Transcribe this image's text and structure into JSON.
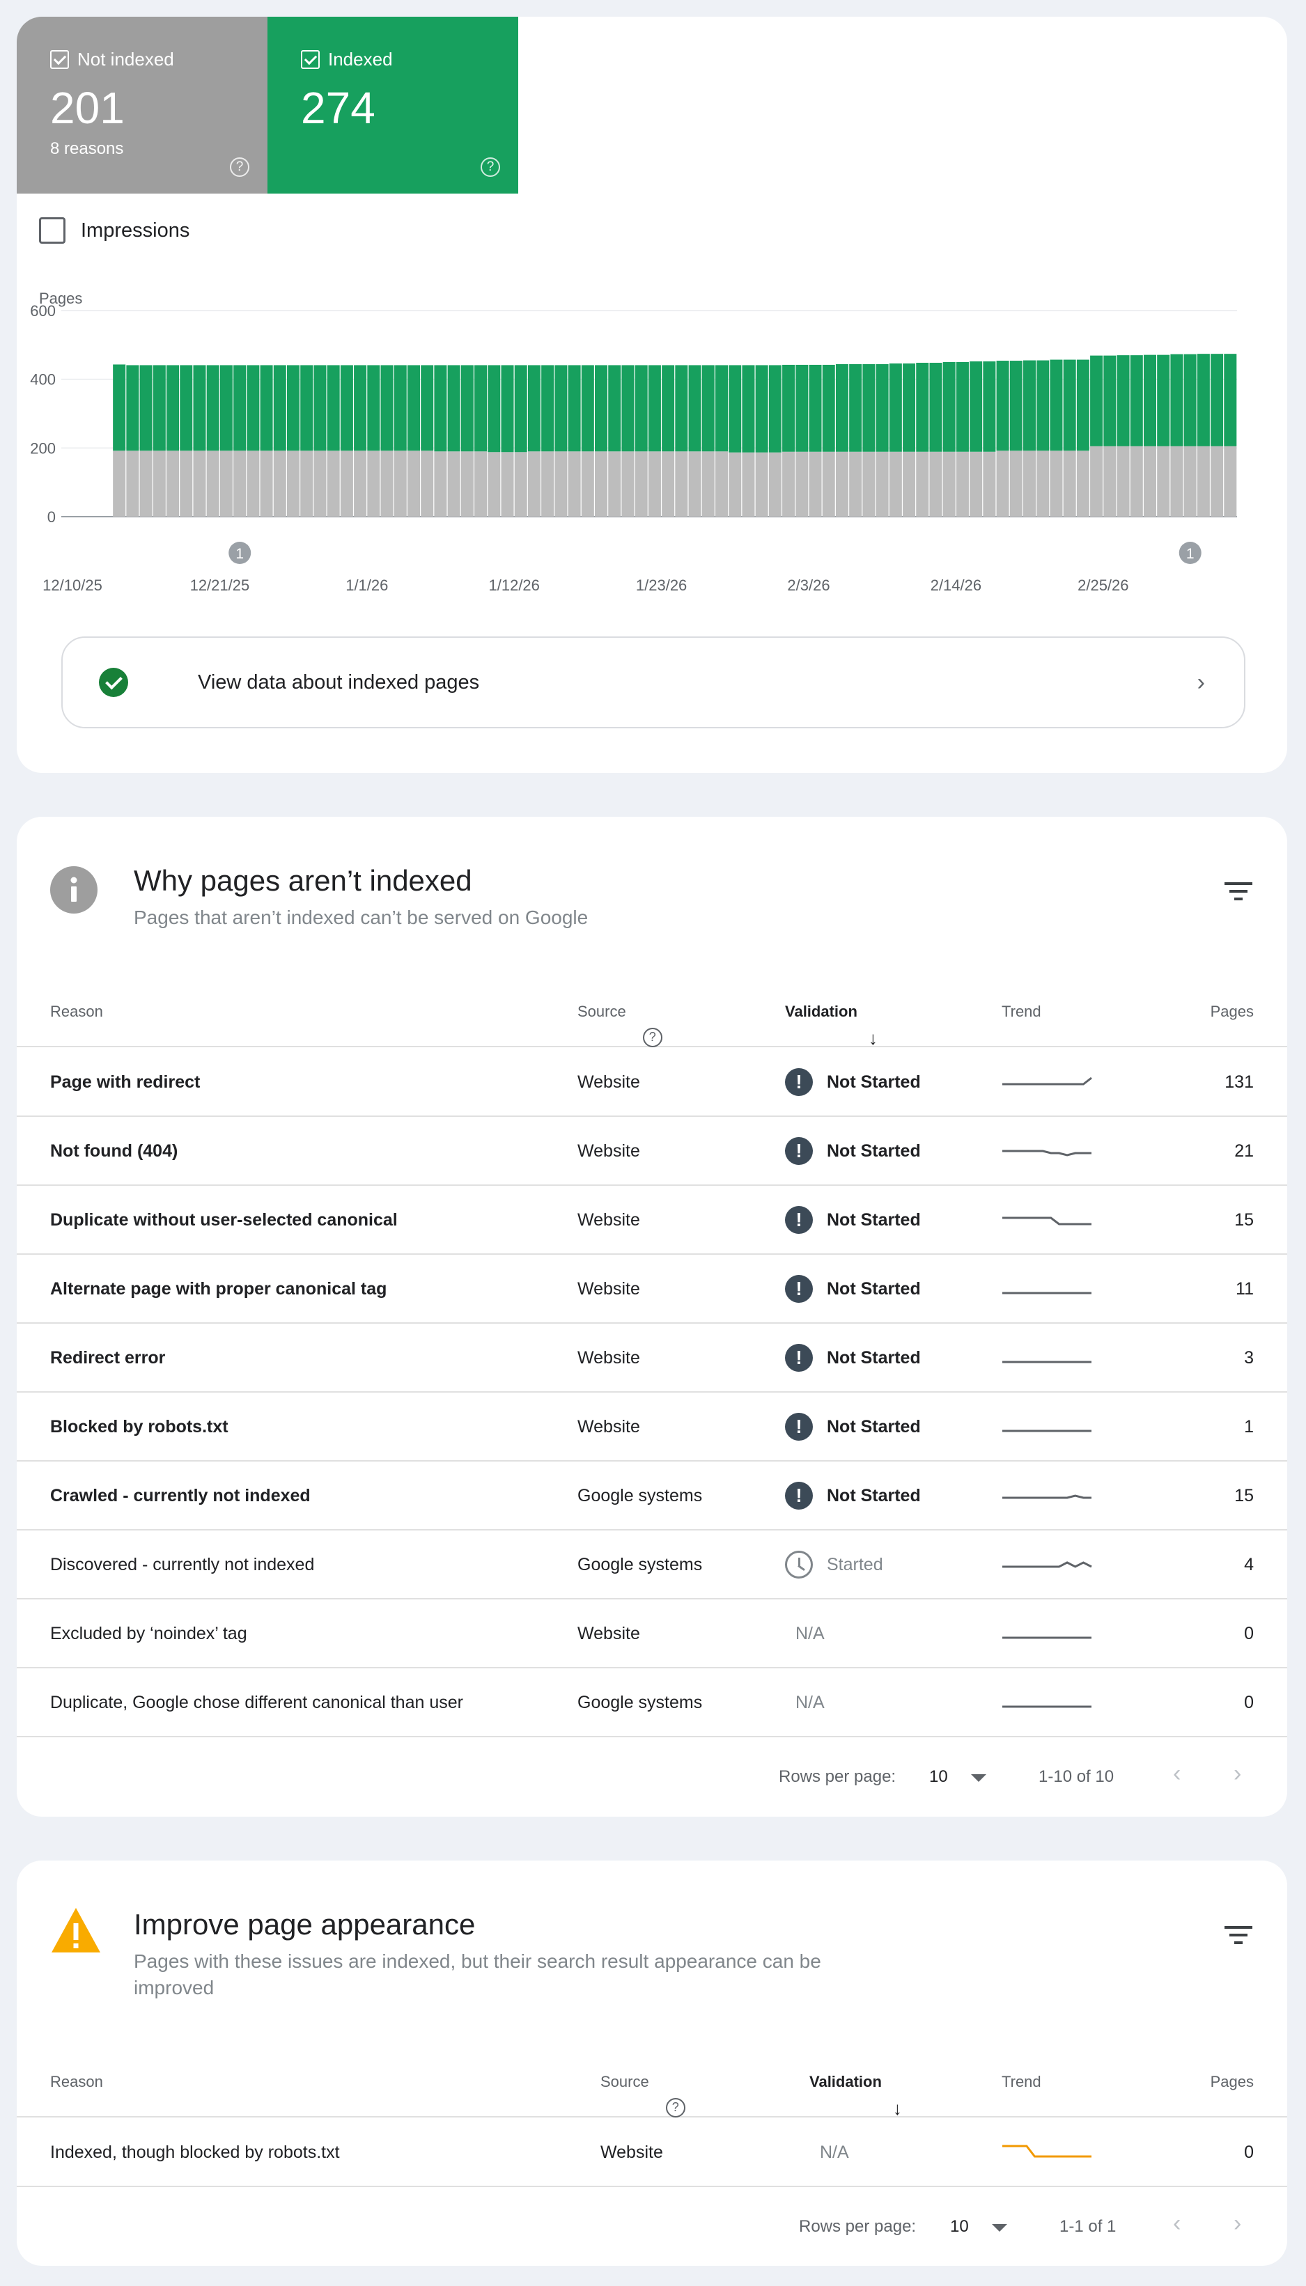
{
  "summary": {
    "not_indexed": {
      "label": "Not indexed",
      "value": "201",
      "sub": "8 reasons",
      "color": "#9e9e9e"
    },
    "indexed": {
      "label": "Indexed",
      "value": "274",
      "color": "#17a05e"
    }
  },
  "impressions_label": "Impressions",
  "chart_data": {
    "type": "bar",
    "stacked": true,
    "ylabel": "Pages",
    "ylim": [
      0,
      600
    ],
    "yticks": [
      "600",
      "400",
      "200",
      "0"
    ],
    "xtick_labels": [
      "12/10/25",
      "12/21/25",
      "1/1/26",
      "1/12/26",
      "1/23/26",
      "2/3/26",
      "2/14/26",
      "2/25/26"
    ],
    "annotations": [
      {
        "label": "1",
        "date": "12/22/25"
      },
      {
        "label": "1",
        "date": "3/3/26"
      }
    ],
    "series": [
      {
        "name": "Not indexed",
        "color": "#bdbdbd",
        "values": [
          192,
          192,
          192,
          192,
          192,
          192,
          192,
          192,
          192,
          192,
          192,
          192,
          192,
          192,
          192,
          192,
          192,
          192,
          192,
          192,
          192,
          192,
          192,
          192,
          190,
          190,
          190,
          190,
          188,
          188,
          188,
          190,
          190,
          190,
          190,
          190,
          190,
          190,
          190,
          190,
          190,
          190,
          190,
          190,
          190,
          190,
          187,
          187,
          187,
          187,
          189,
          189,
          189,
          189,
          189,
          189,
          189,
          189,
          189,
          189,
          189,
          189,
          189,
          189,
          189,
          189,
          192,
          192,
          192,
          192,
          192,
          192,
          192,
          205,
          205,
          205,
          205,
          205,
          205,
          205,
          205,
          205,
          205,
          205
        ]
      },
      {
        "name": "Indexed",
        "color": "#17a05e",
        "values": [
          251,
          249,
          249,
          249,
          249,
          249,
          249,
          249,
          249,
          249,
          249,
          249,
          249,
          249,
          249,
          249,
          249,
          249,
          249,
          249,
          249,
          249,
          249,
          249,
          251,
          251,
          251,
          251,
          253,
          253,
          253,
          251,
          251,
          251,
          251,
          251,
          251,
          251,
          251,
          251,
          251,
          251,
          251,
          251,
          251,
          251,
          254,
          254,
          254,
          254,
          253,
          253,
          253,
          253,
          255,
          255,
          255,
          255,
          257,
          257,
          259,
          259,
          261,
          261,
          263,
          263,
          262,
          262,
          263,
          263,
          265,
          265,
          265,
          264,
          264,
          265,
          265,
          266,
          266,
          268,
          268,
          269,
          269,
          269
        ]
      }
    ]
  },
  "view_data_label": "View data about indexed pages",
  "why": {
    "title": "Why pages aren’t indexed",
    "subtitle": "Pages that aren’t indexed can’t be served on Google",
    "headers": {
      "reason": "Reason",
      "source": "Source",
      "validation": "Validation",
      "trend": "Trend",
      "pages": "Pages"
    },
    "rows": [
      {
        "reason": "Page with redirect",
        "source": "Website",
        "status": "Not Started",
        "kind": "ns",
        "pages": "131",
        "trend": [
          4,
          4,
          4,
          4,
          4,
          4,
          4,
          4,
          4,
          4,
          4,
          1
        ]
      },
      {
        "reason": "Not found (404)",
        "source": "Website",
        "status": "Not Started",
        "kind": "ns",
        "pages": "21",
        "trend": [
          3,
          3,
          3,
          3,
          3,
          3,
          4,
          4,
          5,
          4,
          4,
          4
        ]
      },
      {
        "reason": "Duplicate without user-selected canonical",
        "source": "Website",
        "status": "Not Started",
        "kind": "ns",
        "pages": "15",
        "trend": [
          2,
          2,
          2,
          2,
          2,
          2,
          2,
          5,
          5,
          5,
          5,
          5
        ]
      },
      {
        "reason": "Alternate page with proper canonical tag",
        "source": "Website",
        "status": "Not Started",
        "kind": "ns",
        "pages": "11",
        "trend": [
          5,
          5,
          5,
          5,
          5,
          5,
          5,
          5,
          5,
          5,
          5,
          5
        ]
      },
      {
        "reason": "Redirect error",
        "source": "Website",
        "status": "Not Started",
        "kind": "ns",
        "pages": "3",
        "trend": [
          5,
          5,
          5,
          5,
          5,
          5,
          5,
          5,
          5,
          5,
          5,
          5
        ]
      },
      {
        "reason": "Blocked by robots.txt",
        "source": "Website",
        "status": "Not Started",
        "kind": "ns",
        "pages": "1",
        "trend": [
          5,
          5,
          5,
          5,
          5,
          5,
          5,
          5,
          5,
          5,
          5,
          5
        ]
      },
      {
        "reason": "Crawled - currently not indexed",
        "source": "Google systems",
        "status": "Not Started",
        "kind": "ns",
        "pages": "15",
        "trend": [
          4,
          4,
          4,
          4,
          4,
          4,
          4,
          4,
          4,
          3,
          4,
          4
        ]
      },
      {
        "reason": "Discovered - currently not indexed",
        "source": "Google systems",
        "status": "Started",
        "kind": "started",
        "pages": "4",
        "trend": [
          4,
          4,
          4,
          4,
          4,
          4,
          4,
          4,
          2,
          4,
          2,
          4
        ]
      },
      {
        "reason": "Excluded by ‘noindex’ tag",
        "source": "Website",
        "status": "N/A",
        "kind": "na",
        "pages": "0",
        "trend": [
          5,
          5,
          5,
          5,
          5,
          5,
          5,
          5,
          5,
          5,
          5,
          5
        ]
      },
      {
        "reason": "Duplicate, Google chose different canonical than user",
        "source": "Google systems",
        "status": "N/A",
        "kind": "na",
        "pages": "0",
        "trend": [
          5,
          5,
          5,
          5,
          5,
          5,
          5,
          5,
          5,
          5,
          5,
          5
        ]
      }
    ],
    "pager": {
      "rows_per_page_label": "Rows per page:",
      "rows_per_page": "10",
      "range": "1-10 of 10"
    }
  },
  "appearance": {
    "title": "Improve page appearance",
    "subtitle": "Pages with these issues are indexed, but their search result appearance can be improved",
    "headers": {
      "reason": "Reason",
      "source": "Source",
      "validation": "Validation",
      "trend": "Trend",
      "pages": "Pages"
    },
    "rows": [
      {
        "reason": "Indexed, though blocked by robots.txt",
        "source": "Website",
        "status": "N/A",
        "kind": "na",
        "pages": "0",
        "trend": [
          0,
          0,
          0,
          0,
          5,
          5,
          5,
          5,
          5,
          5,
          5,
          5
        ],
        "trend_color": "#f29900"
      }
    ],
    "pager": {
      "rows_per_page_label": "Rows per page:",
      "rows_per_page": "10",
      "range": "1-1 of 1"
    }
  }
}
